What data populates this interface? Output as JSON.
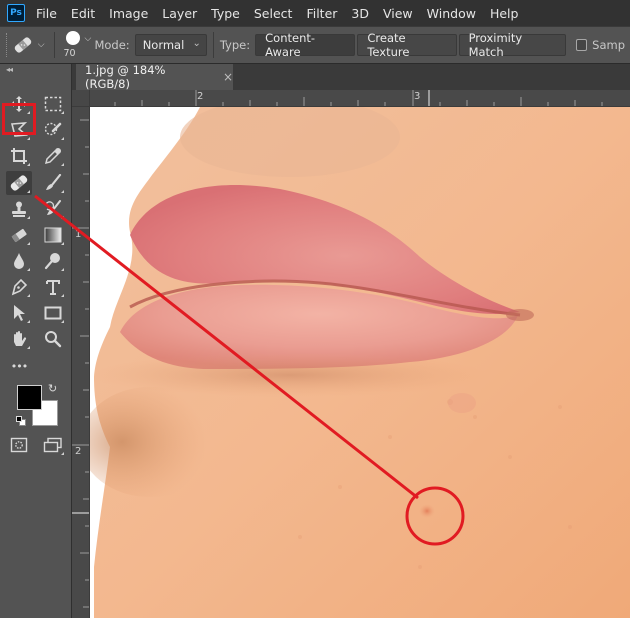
{
  "app": {
    "logo": "Ps"
  },
  "menu": [
    "File",
    "Edit",
    "Image",
    "Layer",
    "Type",
    "Select",
    "Filter",
    "3D",
    "View",
    "Window",
    "Help"
  ],
  "options": {
    "brush_size": "70",
    "mode_label": "Mode:",
    "mode_value": "Normal",
    "type_label": "Type:",
    "type_buttons": [
      "Content-Aware",
      "Create Texture",
      "Proximity Match"
    ],
    "sample_label": "Samp"
  },
  "document": {
    "tab_title": "1.jpg @ 184% (RGB/8)",
    "close_glyph": "×"
  },
  "rulers": {
    "h_labels": [
      "2",
      "3"
    ],
    "v_labels": [
      "1",
      "2"
    ]
  },
  "toolbar": {
    "collapse_glyph": "◂◂",
    "more_glyph": "•••"
  },
  "annotation": {
    "color": "#e11b22"
  },
  "colors": {
    "foreground": "#000000",
    "background": "#ffffff",
    "accent": "#31a8ff"
  }
}
